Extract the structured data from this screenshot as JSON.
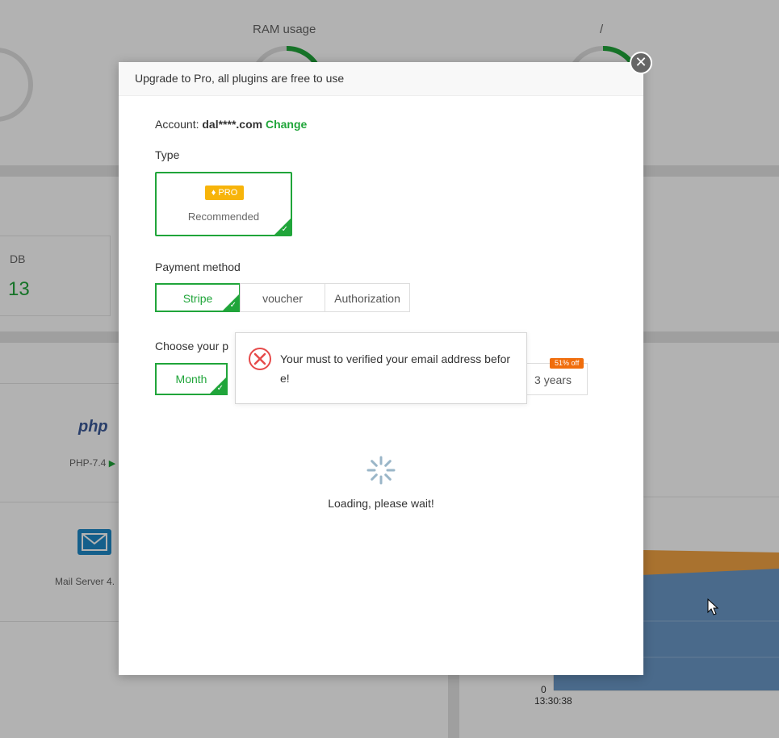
{
  "dashboard": {
    "ram_title": "RAM usage",
    "disk_title": "/",
    "db_label": "DB",
    "db_value": "13",
    "php_logo": "php",
    "php_label": "PHP-7.4",
    "mail_label": "Mail Server 4.",
    "chart_zero": "0",
    "chart_time": "13:30:38",
    "accent": "#20a53a"
  },
  "modal": {
    "title": "Upgrade to Pro, all plugins are free to use",
    "close_icon": "close-icon",
    "account_label": "Account:",
    "account_value": "dal****.com",
    "change_label": "Change",
    "type_label": "Type",
    "type_badge": "PRO",
    "type_sub": "Recommended",
    "payment_label": "Payment method",
    "payment_methods": [
      "Stripe",
      "voucher",
      "Authorization"
    ],
    "plan_label": "Choose your p",
    "plans": [
      "Month",
      "3 years"
    ],
    "discount": "51% off",
    "loading_text": "Loading, please wait!"
  },
  "toast": {
    "message": "Your must to verified your email address before!",
    "icon": "error-icon"
  }
}
